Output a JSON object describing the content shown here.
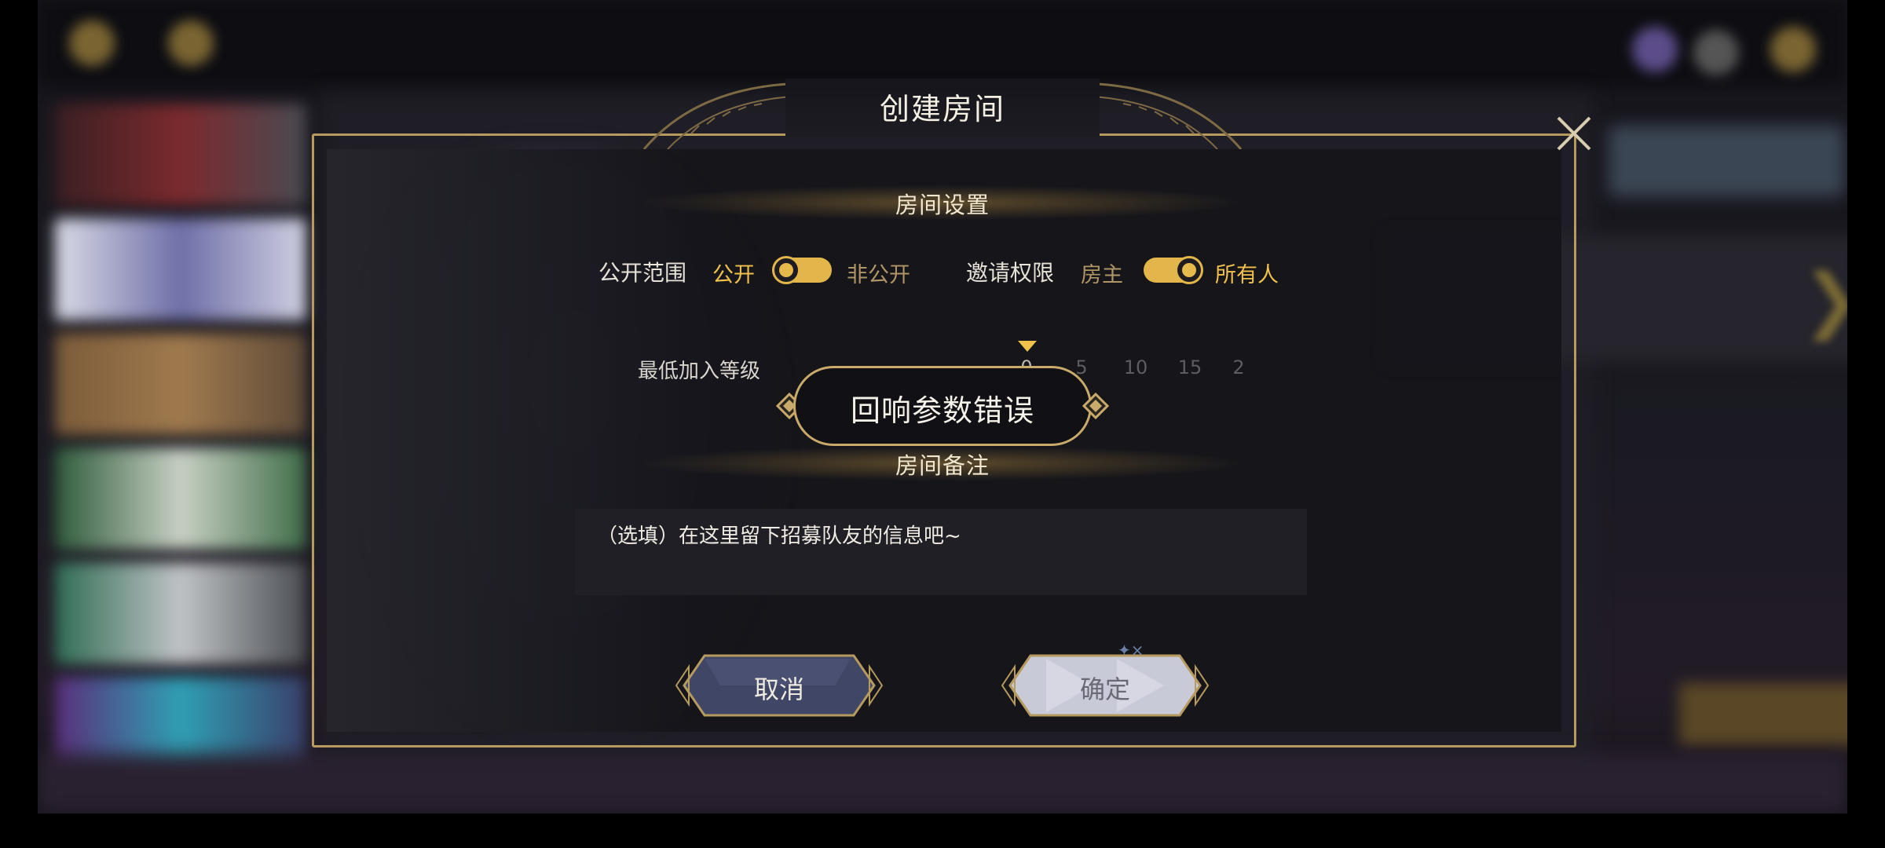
{
  "dialog": {
    "title": "创建房间",
    "close_icon": "close-icon"
  },
  "room_settings": {
    "header": "房间设置",
    "visibility": {
      "label": "公开范围",
      "option_left": "公开",
      "option_right": "非公开",
      "selected": "公开"
    },
    "invite": {
      "label": "邀请权限",
      "option_left": "房主",
      "option_right": "所有人",
      "selected": "所有人"
    },
    "min_level": {
      "label": "最低加入等级",
      "ticks": [
        "0",
        "5",
        "10",
        "15",
        "2"
      ],
      "selected": "0"
    }
  },
  "toast": {
    "message": "回响参数错误"
  },
  "room_note": {
    "header": "房间备注",
    "placeholder": "（选填）在这里留下招募队友的信息吧~"
  },
  "buttons": {
    "cancel": "取消",
    "confirm": "确定"
  },
  "colors": {
    "accent_gold": "#f1c14b",
    "frame_gold": "#b69a5e",
    "cancel_button": "#3f4666",
    "confirm_button": "#c9cad8"
  }
}
